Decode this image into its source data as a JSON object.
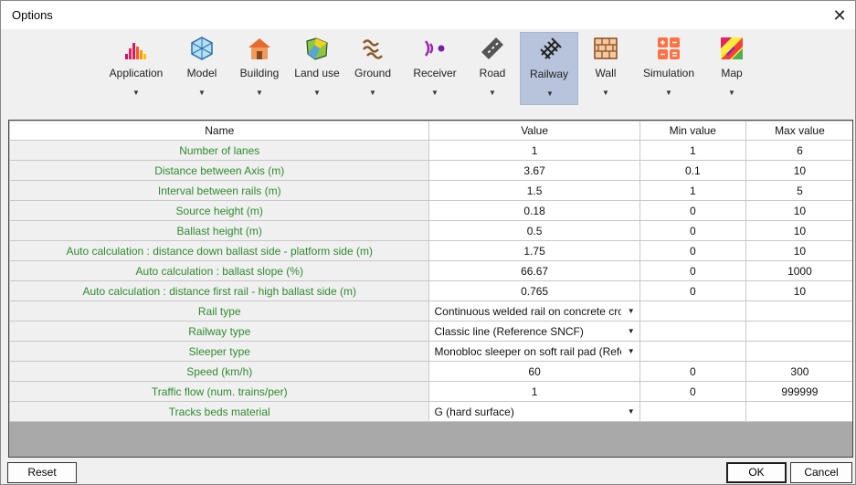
{
  "window": {
    "title": "Options",
    "close_glyph": "✕"
  },
  "toolbar": {
    "items": [
      {
        "label": "Application",
        "icon": "application-icon"
      },
      {
        "label": "Model",
        "icon": "model-icon"
      },
      {
        "label": "Building",
        "icon": "building-icon"
      },
      {
        "label": "Land use",
        "icon": "land-use-icon"
      },
      {
        "label": "Ground",
        "icon": "ground-icon"
      },
      {
        "label": "Receiver",
        "icon": "receiver-icon"
      },
      {
        "label": "Road",
        "icon": "road-icon"
      },
      {
        "label": "Railway",
        "icon": "railway-icon",
        "selected": true
      },
      {
        "label": "Wall",
        "icon": "wall-icon"
      },
      {
        "label": "Simulation",
        "icon": "simulation-icon"
      },
      {
        "label": "Map",
        "icon": "map-icon"
      }
    ],
    "arrow_glyph": "▼"
  },
  "table": {
    "headers": [
      "Name",
      "Value",
      "Min value",
      "Max value"
    ],
    "rows": [
      {
        "name": "Number of lanes",
        "value": "1",
        "min": "1",
        "max": "6"
      },
      {
        "name": "Distance between Axis (m)",
        "value": "3.67",
        "min": "0.1",
        "max": "10"
      },
      {
        "name": "Interval between rails (m)",
        "value": "1.5",
        "min": "1",
        "max": "5"
      },
      {
        "name": "Source height (m)",
        "value": "0.18",
        "min": "0",
        "max": "10"
      },
      {
        "name": "Ballast height (m)",
        "value": "0.5",
        "min": "0",
        "max": "10"
      },
      {
        "name": "Auto calculation : distance down ballast side - platform side (m)",
        "value": "1.75",
        "min": "0",
        "max": "10"
      },
      {
        "name": "Auto calculation : ballast slope (%)",
        "value": "66.67",
        "min": "0",
        "max": "1000"
      },
      {
        "name": "Auto calculation : distance first rail - high ballast side (m)",
        "value": "0.765",
        "min": "0",
        "max": "10"
      },
      {
        "name": "Rail type",
        "value": "Continuous welded rail on concrete cross",
        "min": "",
        "max": "",
        "dropdown": true
      },
      {
        "name": "Railway type",
        "value": "Classic line (Reference SNCF)",
        "min": "",
        "max": "",
        "dropdown": true
      },
      {
        "name": "Sleeper type",
        "value": "Monobloc sleeper on soft rail pad (Refere",
        "min": "",
        "max": "",
        "dropdown": true
      },
      {
        "name": "Speed (km/h)",
        "value": "60",
        "min": "0",
        "max": "300"
      },
      {
        "name": "Traffic flow (num. trains/per)",
        "value": "1",
        "min": "0",
        "max": "999999"
      },
      {
        "name": "Tracks beds material",
        "value": "G (hard surface)",
        "min": "",
        "max": "",
        "dropdown": true
      }
    ],
    "dropdown_glyph": "▼"
  },
  "buttons": {
    "reset": "Reset",
    "ok": "OK",
    "cancel": "Cancel"
  }
}
